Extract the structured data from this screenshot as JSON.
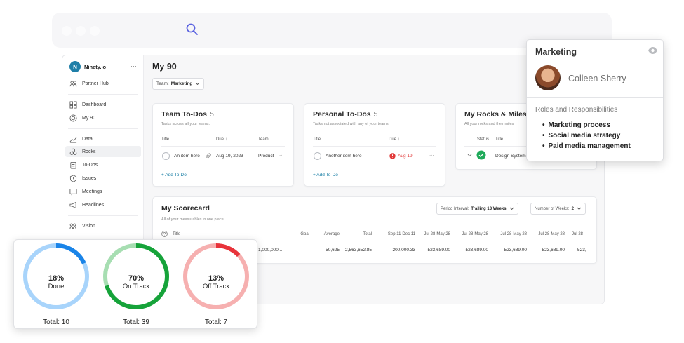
{
  "sidebar": {
    "brand": "Ninety.io",
    "more": "···",
    "items": [
      {
        "label": "Partner Hub",
        "icon": "users-icon"
      },
      {
        "label": "Dashboard",
        "icon": "grid-icon"
      },
      {
        "label": "My 90",
        "icon": "target-icon"
      },
      {
        "label": "Data",
        "icon": "chart-line-icon"
      },
      {
        "label": "Rocks",
        "icon": "rocks-icon"
      },
      {
        "label": "To-Dos",
        "icon": "clipboard-icon"
      },
      {
        "label": "Issues",
        "icon": "shield-alert-icon"
      },
      {
        "label": "Meetings",
        "icon": "message-icon"
      },
      {
        "label": "Headlines",
        "icon": "megaphone-icon"
      },
      {
        "label": "Vision",
        "icon": "vision-icon"
      }
    ]
  },
  "header": {
    "title": "My 90",
    "team_prefix": "Team:",
    "team_value": "Marketing"
  },
  "team_todos": {
    "title": "Team To-Dos",
    "count": "5",
    "subtitle": "Tasks across all your teams.",
    "columns": [
      "Title",
      "Due ↓",
      "Team"
    ],
    "row": {
      "title": "An item here",
      "due": "Aug 19, 2023",
      "team": "Product",
      "more": "···"
    },
    "add": "+ Add To-Do"
  },
  "personal_todos": {
    "title": "Personal To-Dos",
    "count": "5",
    "subtitle": "Tasks not associated with any of your teams.",
    "columns": [
      "Title",
      "Due ↓"
    ],
    "row": {
      "title": "Another item here",
      "due": "Aug 19",
      "more": "···"
    },
    "add": "+ Add To-Do"
  },
  "rocks": {
    "title": "My Rocks & Milesto",
    "subtitle": "All your rocks and their miles",
    "columns": [
      "Status",
      "Title"
    ],
    "row": {
      "title": "Design System"
    }
  },
  "scorecard": {
    "title": "My Scorecard",
    "subtitle": "All of your measurables in one place",
    "period_label": "Period Interval:",
    "period_value": "Trailing 13 Weeks",
    "weeks_label": "Number of Weeks:",
    "weeks_value": "2",
    "columns": [
      "Title",
      "Goal",
      "Average",
      "Total",
      "Sep 11-Dec 11",
      "Jul 28-May 28",
      "Jul 28-May 28",
      "Jul 28-May 28",
      "Jul 28-May 28",
      "Jul 28-"
    ],
    "row": [
      "1,000,000...",
      "50,625",
      "2,563,652.85",
      "200,000.33",
      "523,689.00",
      "523,689.00",
      "523,689.00",
      "523,689.00",
      "523,"
    ]
  },
  "popup": {
    "title": "Marketing",
    "name": "Colleen Sherry",
    "subtitle": "Roles and Responsibilities",
    "items": [
      "Marketing process",
      "Social media strategy",
      "Paid media management"
    ]
  },
  "stats": [
    {
      "pct": "18%",
      "label": "Done",
      "total": "Total: 10",
      "value": 0.18,
      "track": "#a8d4fb",
      "fill": "#1a84e8"
    },
    {
      "pct": "70%",
      "label": "On Track",
      "total": "Total: 39",
      "value": 0.7,
      "track": "#a7deb2",
      "fill": "#16a33a"
    },
    {
      "pct": "13%",
      "label": "Off Track",
      "total": "Total: 7",
      "value": 0.13,
      "track": "#f6b0b0",
      "fill": "#e8333a"
    }
  ],
  "colors": {
    "accent": "#1a7fa6",
    "overdue": "#e23b3b",
    "success": "#1faa5a"
  }
}
